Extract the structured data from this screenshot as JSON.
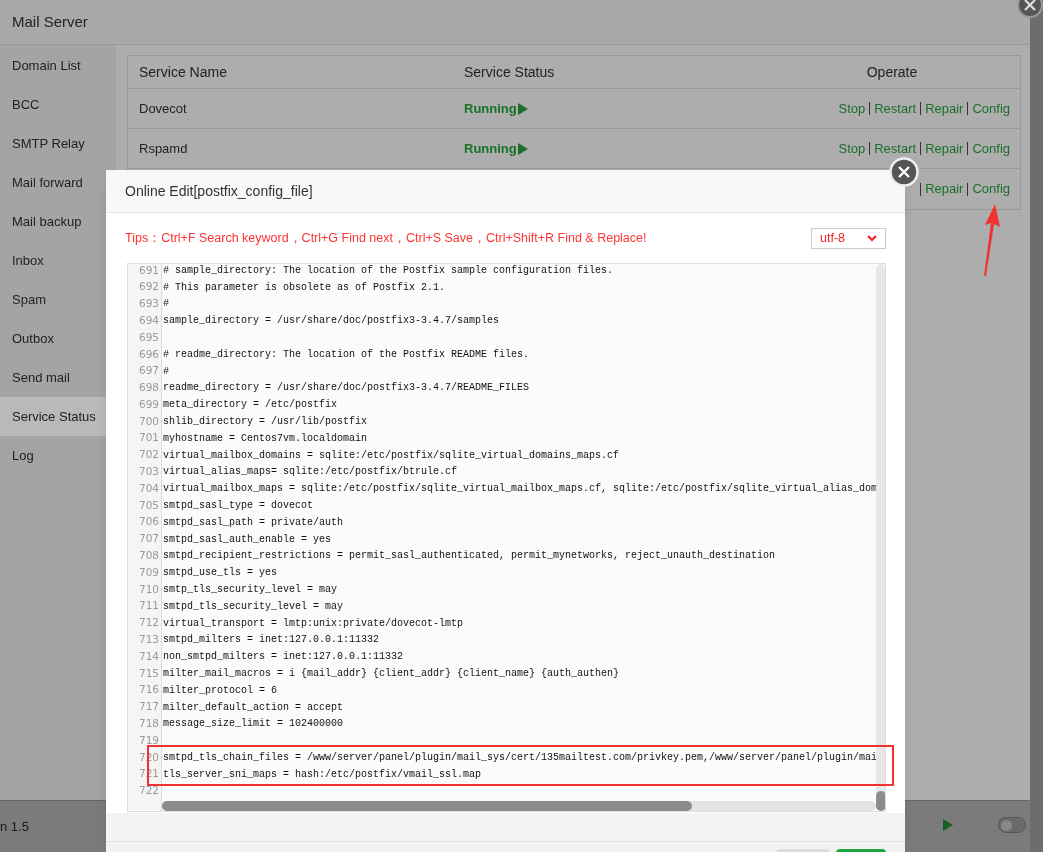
{
  "window": {
    "title": "Mail Server"
  },
  "sidebar": {
    "items": [
      {
        "label": "Domain List",
        "selected": false
      },
      {
        "label": "BCC",
        "selected": false
      },
      {
        "label": "SMTP Relay",
        "selected": false
      },
      {
        "label": "Mail forward",
        "selected": false
      },
      {
        "label": "Mail backup",
        "selected": false
      },
      {
        "label": "Inbox",
        "selected": false
      },
      {
        "label": "Spam",
        "selected": false
      },
      {
        "label": "Outbox",
        "selected": false
      },
      {
        "label": "Send mail",
        "selected": false
      },
      {
        "label": "Service Status",
        "selected": true
      },
      {
        "label": "Log",
        "selected": false
      }
    ]
  },
  "table": {
    "columns": [
      "Service Name",
      "Service Status",
      "Operate"
    ],
    "rows": [
      {
        "name": "Dovecot",
        "status": "Running",
        "operations": [
          "Stop",
          "Restart",
          "Repair",
          "Config"
        ]
      },
      {
        "name": "Rspamd",
        "status": "Running",
        "operations": [
          "Stop",
          "Restart",
          "Repair",
          "Config"
        ]
      },
      {
        "operations": [
          "Repair",
          "Config"
        ]
      }
    ]
  },
  "editor": {
    "title": "Online Edit[postfix_config_file]",
    "tips": "Tips：Ctrl+F Search keyword，Ctrl+G Find next，Ctrl+S Save，Ctrl+Shift+R Find & Replace!",
    "encoding": "utf-8",
    "lines": [
      {
        "number": "691",
        "text": "# sample_directory: The location of the Postfix sample configuration files."
      },
      {
        "number": "692",
        "text": "# This parameter is obsolete as of Postfix 2.1."
      },
      {
        "number": "693",
        "text": "#"
      },
      {
        "number": "694",
        "text": "sample_directory = /usr/share/doc/postfix3-3.4.7/samples"
      },
      {
        "number": "695"
      },
      {
        "number": "696",
        "text": "# readme_directory: The location of the Postfix README files."
      },
      {
        "number": "697",
        "text": "#"
      },
      {
        "number": "698",
        "text": "readme_directory = /usr/share/doc/postfix3-3.4.7/README_FILES"
      },
      {
        "number": "699",
        "text": "meta_directory = /etc/postfix"
      },
      {
        "number": "700",
        "text": "shlib_directory = /usr/lib/postfix"
      },
      {
        "number": "701",
        "text": "myhostname = Centos7vm.localdomain"
      },
      {
        "number": "702",
        "text": "virtual_mailbox_domains = sqlite:/etc/postfix/sqlite_virtual_domains_maps.cf"
      },
      {
        "number": "703",
        "text": "virtual_alias_maps= sqlite:/etc/postfix/btrule.cf"
      },
      {
        "number": "704",
        "text": "virtual_mailbox_maps = sqlite:/etc/postfix/sqlite_virtual_mailbox_maps.cf, sqlite:/etc/postfix/sqlite_virtual_alias_dom"
      },
      {
        "number": "705",
        "text": "smtpd_sasl_type = dovecot"
      },
      {
        "number": "706",
        "text": "smtpd_sasl_path = private/auth"
      },
      {
        "number": "707",
        "text": "smtpd_sasl_auth_enable = yes"
      },
      {
        "number": "708",
        "text": "smtpd_recipient_restrictions = permit_sasl_authenticated, permit_mynetworks, reject_unauth_destination"
      },
      {
        "number": "709",
        "text": "smtpd_use_tls = yes"
      },
      {
        "number": "710",
        "text": "smtp_tls_security_level = may"
      },
      {
        "number": "711",
        "text": "smtpd_tls_security_level = may"
      },
      {
        "number": "712",
        "text": "virtual_transport = lmtp:unix:private/dovecot-lmtp"
      },
      {
        "number": "713",
        "text": "smtpd_milters = inet:127.0.0.1:11332"
      },
      {
        "number": "714",
        "text": "non_smtpd_milters = inet:127.0.0.1:11332"
      },
      {
        "number": "715",
        "text": "milter_mail_macros = i {mail_addr} {client_addr} {client_name} {auth_authen}"
      },
      {
        "number": "716",
        "text": "milter_protocol = 6"
      },
      {
        "number": "717",
        "text": "milter_default_action = accept"
      },
      {
        "number": "718",
        "text": "message_size_limit = 102400000"
      },
      {
        "number": "719"
      },
      {
        "number": "720",
        "text": "smtpd_tls_chain_files = /www/server/panel/plugin/mail_sys/cert/135mailtest.com/privkey.pem,/www/server/panel/plugin/mai"
      },
      {
        "number": "721",
        "text": "tls_server_sni_maps = hash:/etc/postfix/vmail_ssl.map"
      },
      {
        "number": "722"
      }
    ]
  },
  "background": {
    "version_text": "n 1.5",
    "toggle": {
      "on": false
    }
  }
}
